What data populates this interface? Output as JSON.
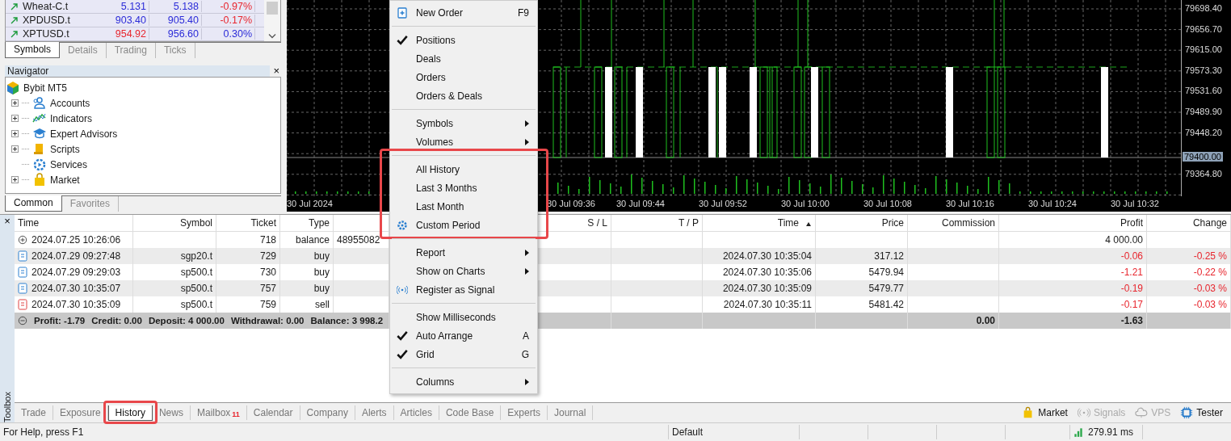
{
  "market_watch": {
    "rows": [
      {
        "symbol": "Wheat-C.t",
        "bid": "5.131",
        "ask": "5.138",
        "change": "-0.97%",
        "bid_down": false,
        "change_down": true
      },
      {
        "symbol": "XPDUSD.t",
        "bid": "903.40",
        "ask": "905.40",
        "change": "-0.17%",
        "bid_down": false,
        "change_down": true
      },
      {
        "symbol": "XPTUSD.t",
        "bid": "954.92",
        "ask": "956.60",
        "change": "0.30%",
        "bid_down": true,
        "change_down": false
      }
    ],
    "tabs": [
      {
        "label": "Symbols",
        "selected": true
      },
      {
        "label": "Details",
        "selected": false
      },
      {
        "label": "Trading",
        "selected": false
      },
      {
        "label": "Ticks",
        "selected": false
      }
    ]
  },
  "navigator": {
    "title": "Navigator",
    "close": "×",
    "root": {
      "label": "Bybit MT5",
      "children": [
        {
          "label": "Accounts",
          "kind": "folder"
        },
        {
          "label": "Indicators",
          "kind": "folder"
        },
        {
          "label": "Expert Advisors",
          "kind": "folder"
        },
        {
          "label": "Scripts",
          "kind": "folder"
        },
        {
          "label": "Services",
          "kind": "leaf"
        },
        {
          "label": "Market",
          "kind": "folder"
        }
      ]
    },
    "tabs": [
      {
        "label": "Common",
        "selected": true
      },
      {
        "label": "Favorites",
        "selected": false
      }
    ]
  },
  "chart": {
    "price_labels": [
      "79698.40",
      "79656.70",
      "79615.00",
      "79573.30",
      "79531.60",
      "79489.90",
      "79448.20",
      "79364.80"
    ],
    "current_price": "79400.00",
    "time_labels": [
      "30 Jul 2024",
      "30 Jul 09:36",
      "30 Jul 09:44",
      "30 Jul 09:52",
      "30 Jul 10:00",
      "30 Jul 10:08",
      "30 Jul 10:16",
      "30 Jul 10:24",
      "30 Jul 10:32"
    ]
  },
  "context_menu": {
    "groups": [
      {
        "highlighted": false,
        "items": [
          {
            "label": "New Order",
            "shortcut": "F9",
            "checked": false,
            "submenu": false
          }
        ]
      },
      {
        "highlighted": false,
        "items": [
          {
            "label": "Positions",
            "checked": true,
            "submenu": false
          },
          {
            "label": "Deals",
            "checked": false,
            "submenu": false
          },
          {
            "label": "Orders",
            "checked": false,
            "submenu": false
          },
          {
            "label": "Orders & Deals",
            "checked": false,
            "submenu": false
          }
        ]
      },
      {
        "highlighted": false,
        "items": [
          {
            "label": "Symbols",
            "checked": false,
            "submenu": true
          },
          {
            "label": "Volumes",
            "checked": false,
            "submenu": true
          }
        ]
      },
      {
        "highlighted": true,
        "items": [
          {
            "label": "All History",
            "checked": false,
            "submenu": false
          },
          {
            "label": "Last 3 Months",
            "checked": false,
            "submenu": false
          },
          {
            "label": "Last Month",
            "checked": false,
            "submenu": false
          },
          {
            "label": "Custom Period",
            "checked": false,
            "submenu": false
          }
        ]
      },
      {
        "highlighted": false,
        "items": [
          {
            "label": "Report",
            "checked": false,
            "submenu": true
          },
          {
            "label": "Show on Charts",
            "checked": false,
            "submenu": true
          },
          {
            "label": "Register as Signal",
            "checked": false,
            "submenu": false
          }
        ]
      },
      {
        "highlighted": false,
        "items": [
          {
            "label": "Show Milliseconds",
            "checked": false,
            "submenu": false
          },
          {
            "label": "Auto Arrange",
            "shortcut": "A",
            "checked": true,
            "submenu": false
          },
          {
            "label": "Grid",
            "shortcut": "G",
            "checked": true,
            "submenu": false
          }
        ]
      },
      {
        "highlighted": false,
        "items": [
          {
            "label": "Columns",
            "checked": false,
            "submenu": true
          }
        ]
      }
    ]
  },
  "toolbox": {
    "title": "Toolbox",
    "close": "×",
    "columns": [
      {
        "label": "Time",
        "sorted": false
      },
      {
        "label": "Symbol",
        "sorted": false
      },
      {
        "label": "Ticket",
        "sorted": false
      },
      {
        "label": "Type",
        "sorted": false
      },
      {
        "label": "S / L",
        "sorted": false
      },
      {
        "label": "T / P",
        "sorted": false
      },
      {
        "label": "Time",
        "sorted": true
      },
      {
        "label": "Price",
        "sorted": false
      },
      {
        "label": "Commission",
        "sorted": false
      },
      {
        "label": "Profit",
        "sorted": false
      },
      {
        "label": "Change",
        "sorted": false
      }
    ],
    "rows": [
      {
        "kind": "balance",
        "time": "2024.07.25 10:26:06",
        "ticket": "718",
        "type": "balance",
        "comment": "48955082",
        "profit": "4 000.00",
        "loss": false
      },
      {
        "kind": "buy",
        "time": "2024.07.29 09:27:48",
        "symbol": "sgp20.t",
        "ticket": "729",
        "type": "buy",
        "close_time": "2024.07.30 10:35:04",
        "price": "317.12",
        "profit": "-0.06",
        "change": "-0.25 %",
        "loss": true
      },
      {
        "kind": "buy",
        "time": "2024.07.29 09:29:03",
        "symbol": "sp500.t",
        "ticket": "730",
        "type": "buy",
        "close_time": "2024.07.30 10:35:06",
        "price": "5479.94",
        "profit": "-1.21",
        "change": "-0.22 %",
        "loss": true
      },
      {
        "kind": "buy",
        "time": "2024.07.30 10:35:07",
        "symbol": "sp500.t",
        "ticket": "757",
        "type": "buy",
        "close_time": "2024.07.30 10:35:09",
        "price": "5479.77",
        "profit": "-0.19",
        "change": "-0.03 %",
        "loss": true
      },
      {
        "kind": "sell",
        "time": "2024.07.30 10:35:09",
        "symbol": "sp500.t",
        "ticket": "759",
        "type": "sell",
        "close_time": "2024.07.30 10:35:11",
        "price": "5481.42",
        "profit": "-0.17",
        "change": "-0.03 %",
        "loss": true
      }
    ],
    "summary": {
      "items": [
        "Profit: -1.79",
        "Credit: 0.00",
        "Deposit: 4 000.00",
        "Withdrawal: 0.00",
        "Balance: 3 998.2"
      ],
      "commission": "0.00",
      "profit": "-1.63"
    },
    "tabs": [
      {
        "label": "Trade",
        "selected": false,
        "highlighted": false
      },
      {
        "label": "Exposure",
        "selected": false,
        "highlighted": false
      },
      {
        "label": "History",
        "selected": true,
        "highlighted": true
      },
      {
        "label": "News",
        "selected": false,
        "highlighted": false
      },
      {
        "label": "Mailbox",
        "badge": "11",
        "selected": false,
        "highlighted": false
      },
      {
        "label": "Calendar",
        "selected": false,
        "highlighted": false
      },
      {
        "label": "Company",
        "selected": false,
        "highlighted": false
      },
      {
        "label": "Alerts",
        "selected": false,
        "highlighted": false
      },
      {
        "label": "Articles",
        "selected": false,
        "highlighted": false
      },
      {
        "label": "Code Base",
        "selected": false,
        "highlighted": false
      },
      {
        "label": "Experts",
        "selected": false,
        "highlighted": false
      },
      {
        "label": "Journal",
        "selected": false,
        "highlighted": false
      }
    ],
    "tools": [
      {
        "label": "Market",
        "disabled": false
      },
      {
        "label": "Signals",
        "disabled": true
      },
      {
        "label": "VPS",
        "disabled": true
      },
      {
        "label": "Tester",
        "disabled": false
      }
    ]
  },
  "status_bar": {
    "help": "For Help, press F1",
    "profile": "Default",
    "ping": "279.91 ms"
  }
}
